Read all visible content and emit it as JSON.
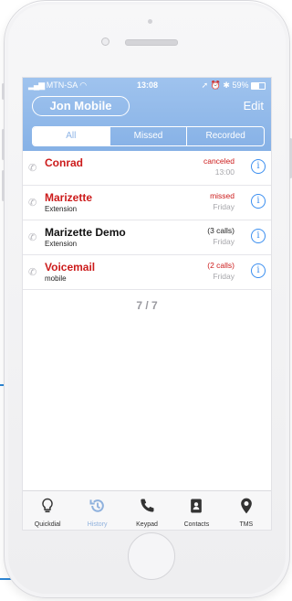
{
  "status_bar": {
    "carrier": "MTN-SA",
    "time": "13:08",
    "battery": "59%",
    "battery_fraction": 0.59
  },
  "header": {
    "account_label": "Jon Mobile",
    "edit_label": "Edit"
  },
  "filter_tabs": [
    {
      "label": "All",
      "active": true
    },
    {
      "label": "Missed",
      "active": false
    },
    {
      "label": "Recorded",
      "active": false
    }
  ],
  "calls": [
    {
      "name": "Conrad",
      "subtitle": "",
      "status": "canceled",
      "time": "13:00",
      "name_red": true,
      "status_red": true
    },
    {
      "name": "Marizette",
      "subtitle": "Extension",
      "status": "missed",
      "time": "Friday",
      "name_red": true,
      "status_red": true
    },
    {
      "name": "Marizette Demo",
      "subtitle": "Extension",
      "status": "(3 calls)",
      "time": "Friday",
      "name_red": false,
      "status_red": false
    },
    {
      "name": "Voicemail",
      "subtitle": "mobile",
      "status": "(2 calls)",
      "time": "Friday",
      "name_red": true,
      "status_red": true
    }
  ],
  "pager": "7 / 7",
  "info_glyph": "i",
  "tab_bar": [
    {
      "label": "Quickdial",
      "icon": "lightbulb-icon",
      "active": false
    },
    {
      "label": "History",
      "icon": "history-icon",
      "active": true
    },
    {
      "label": "Keypad",
      "icon": "phone-icon",
      "active": false
    },
    {
      "label": "Contacts",
      "icon": "contacts-icon",
      "active": false
    },
    {
      "label": "TMS",
      "icon": "location-pin-icon",
      "active": false
    }
  ],
  "colors": {
    "header_blue": "#8fb5e6",
    "missed_red": "#cc1b1b",
    "info_blue": "#3a8ef0"
  }
}
